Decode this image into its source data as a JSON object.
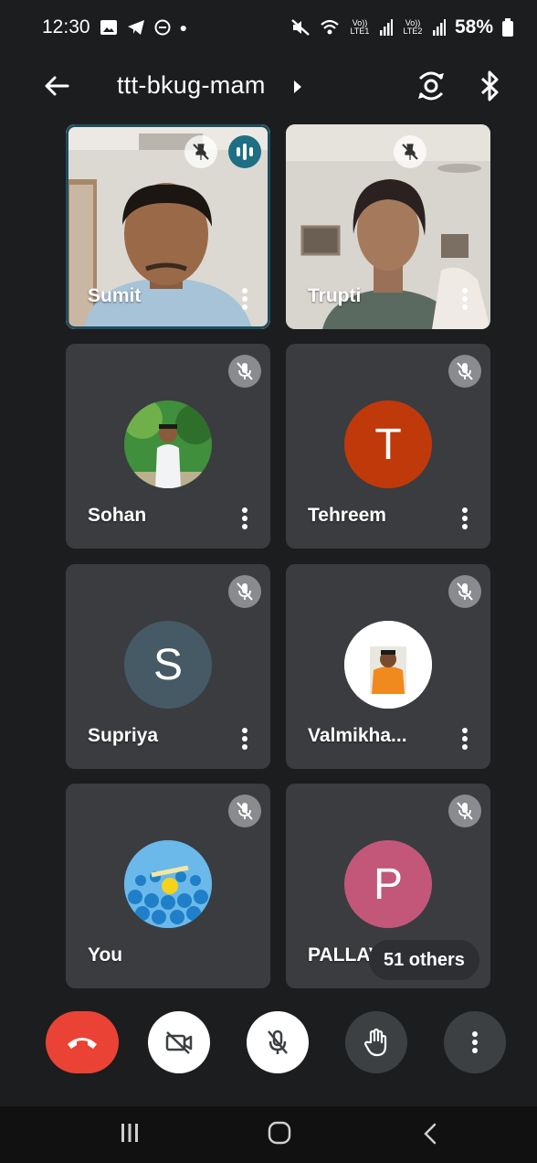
{
  "status_bar": {
    "time": "12:30",
    "sim1": "Vo)) LTE1",
    "sim2": "Vo)) LTE2",
    "battery": "58%"
  },
  "header": {
    "meeting_code": "ttt-bkug-mam"
  },
  "participants": [
    {
      "name": "Sumit",
      "type": "video",
      "speaking": true
    },
    {
      "name": "Trupti",
      "type": "video"
    },
    {
      "name": "Sohan",
      "type": "photo",
      "muted": true
    },
    {
      "name": "Tehreem",
      "type": "initial",
      "initial": "T",
      "color": "#c0390b",
      "muted": true
    },
    {
      "name": "Supriya",
      "type": "initial",
      "initial": "S",
      "color": "#455a64",
      "muted": true
    },
    {
      "name": "Valmikha...",
      "type": "photo",
      "muted": true
    },
    {
      "name": "You",
      "type": "photo",
      "muted": true
    },
    {
      "name": "PALLAV",
      "type": "initial",
      "initial": "P",
      "color": "#c2577a",
      "muted": true
    }
  ],
  "others_chip": "51 others",
  "colors": {
    "background": "#1c1d1f",
    "tile": "#3b3c3f",
    "end_call": "#ea4335",
    "speaking": "#1f6f84"
  },
  "icons": {
    "back": "arrow-left-icon",
    "flip": "camera-switch-icon",
    "bluetooth": "bluetooth-icon",
    "end": "phone-hangup-icon",
    "camera": "video-off-icon",
    "mic": "mic-off-icon",
    "hand": "raise-hand-icon",
    "more": "more-vertical-icon"
  }
}
